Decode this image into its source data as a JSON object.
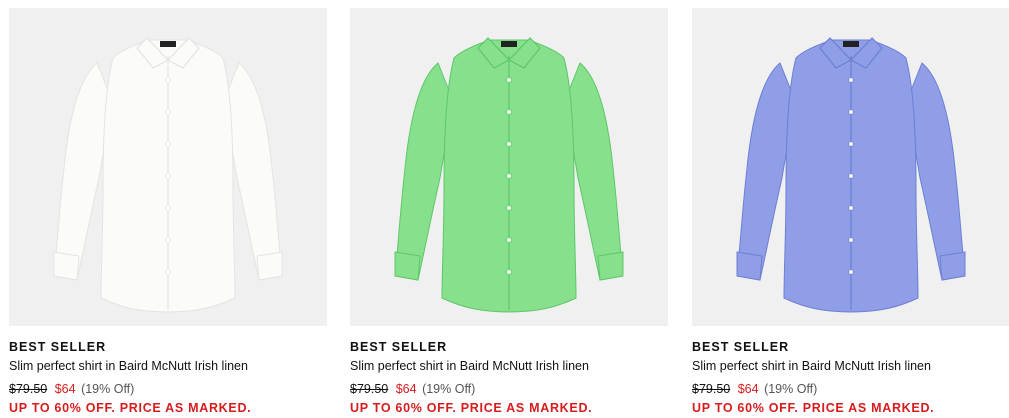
{
  "products": [
    {
      "badge": "BEST SELLER",
      "name": "Slim perfect shirt in Baird McNutt Irish linen",
      "original_price": "$79.50",
      "sale_price": "$64",
      "discount": "(19% Off)",
      "promo": "UP TO 60% OFF. PRICE AS MARKED.",
      "shirt_color": "#fbfbf9",
      "shirt_shade": "#e4e4df"
    },
    {
      "badge": "BEST SELLER",
      "name": "Slim perfect shirt in Baird McNutt Irish linen",
      "original_price": "$79.50",
      "sale_price": "$64",
      "discount": "(19% Off)",
      "promo": "UP TO 60% OFF. PRICE AS MARKED.",
      "shirt_color": "#86e08c",
      "shirt_shade": "#5fc66a"
    },
    {
      "badge": "BEST SELLER",
      "name": "Slim perfect shirt in Baird McNutt Irish linen",
      "original_price": "$79.50",
      "sale_price": "$64",
      "discount": "(19% Off)",
      "promo": "UP TO 60% OFF. PRICE AS MARKED.",
      "shirt_color": "#8f9ee6",
      "shirt_shade": "#6e7fd4"
    }
  ],
  "colors": {
    "sale": "#d61c1c",
    "image_bg": "#f0f0f0",
    "text": "#111111"
  }
}
